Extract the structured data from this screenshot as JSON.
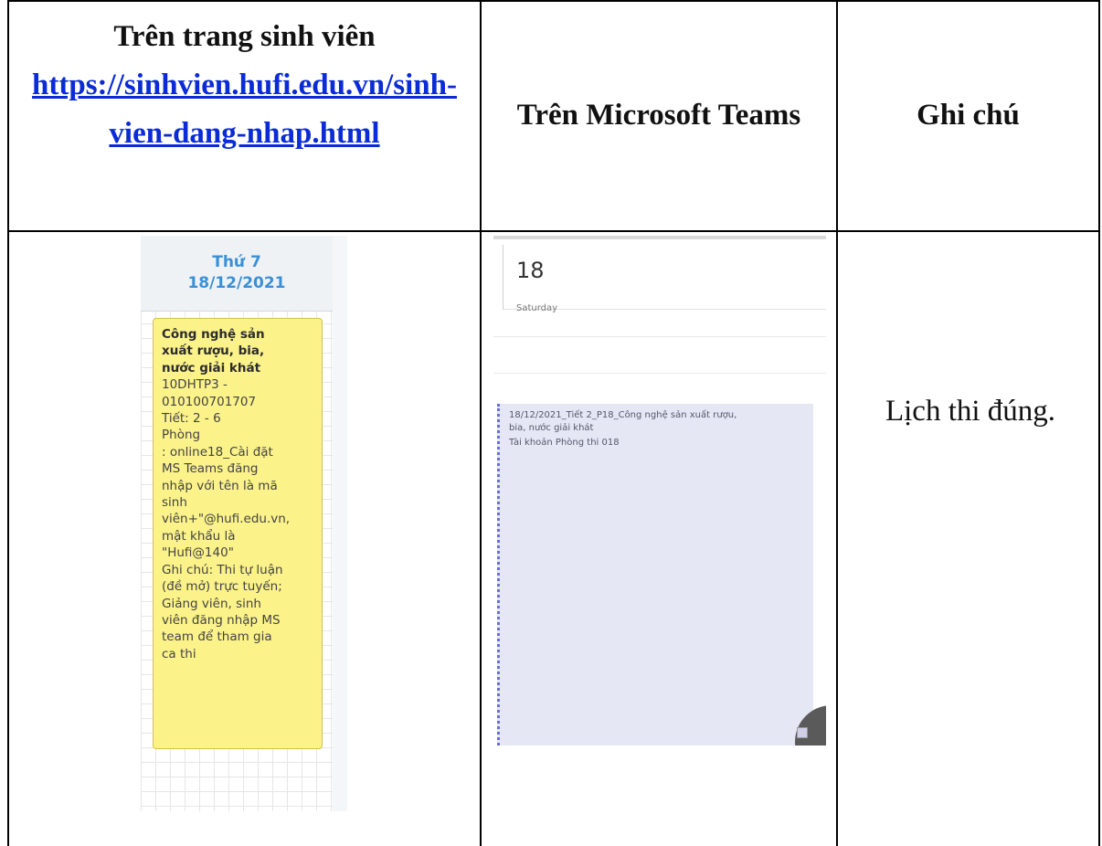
{
  "header": {
    "col1_title": "Trên trang sinh viên",
    "col1_link_line1": "https://sinhvien.hufi.edu.vn/sinh-",
    "col1_link_line2": "vien-dang-nhap.html",
    "col2_title": "Trên Microsoft Teams",
    "col3_title": "Ghi chú"
  },
  "portal": {
    "day_label": "Thứ 7",
    "date": "18/12/2021",
    "card_subject_lines": [
      "Công nghệ sản",
      "xuất rượu, bia,",
      "nước giải khát"
    ],
    "card_lines": [
      "10DHTP3 -",
      "010100701707",
      "Tiết: 2 - 6",
      "Phòng",
      ": online18_Cài đặt",
      "MS Teams đăng",
      "nhập với tên là mã",
      "sinh",
      "viên+\"@hufi.edu.vn,",
      "mật khẩu là",
      "\"Hufi@140\"",
      "Ghi chú: Thi tự luận",
      "(đề mở) trực tuyến;",
      "Giảng viên, sinh",
      "viên đăng nhập MS",
      "team để tham gia",
      "ca thi"
    ]
  },
  "teams": {
    "day_number": "18",
    "day_name": "Saturday",
    "event_title_line1": "18/12/2021_Tiết 2_P18_Công nghệ sản xuất rượu,",
    "event_title_line2": "bia, nước giải khát",
    "event_room": "Tài khoản Phòng thi 018"
  },
  "note": {
    "text": "Lịch thi đúng."
  },
  "colors": {
    "link": "#0a2bd6",
    "card_bg": "#fbf28a",
    "portal_date": "#3b8fd6",
    "teams_event_bg": "#e6e7f5",
    "teams_event_border": "#6b6fd0"
  }
}
